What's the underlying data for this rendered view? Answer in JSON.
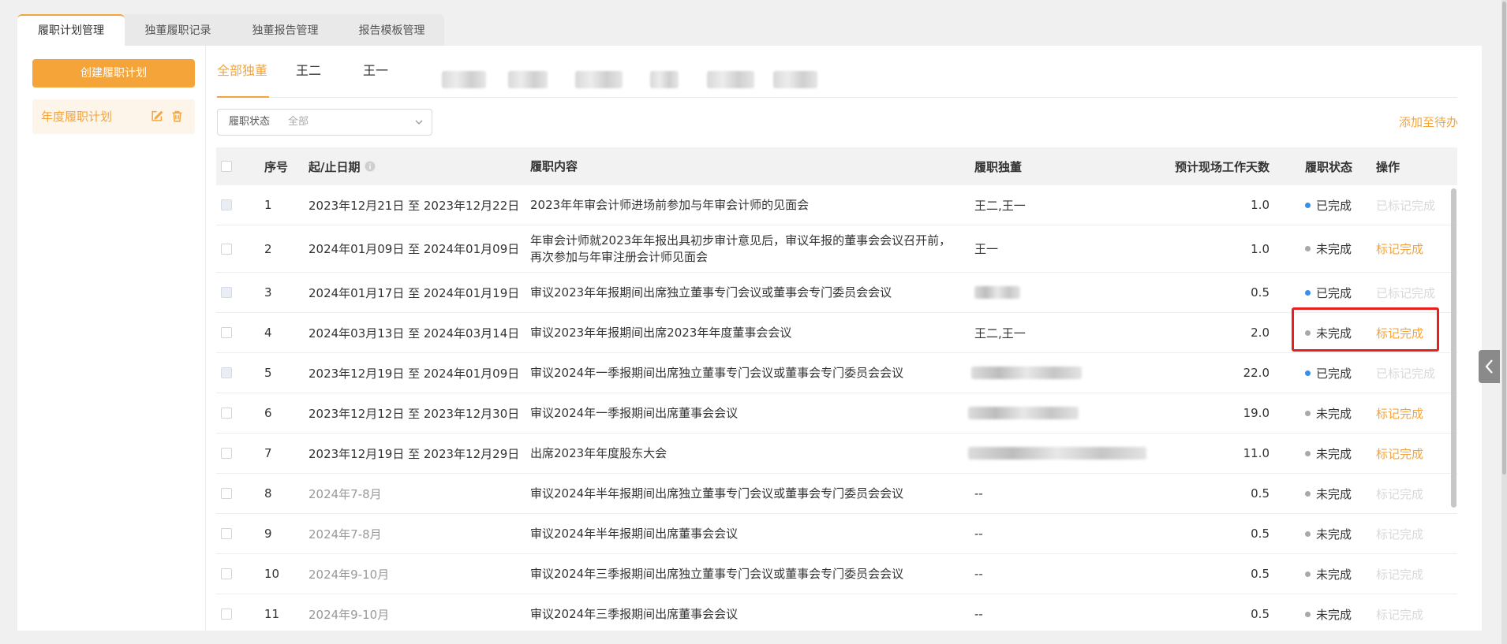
{
  "tabs": [
    "履职计划管理",
    "独董履职记录",
    "独董报告管理",
    "报告模板管理"
  ],
  "left": {
    "create_button": "创建履职计划",
    "plan_item": "年度履职计划"
  },
  "subtabs": {
    "all": "全部独董",
    "names": [
      "王二",
      "王一"
    ]
  },
  "filter": {
    "label": "履职状态",
    "value": "全部"
  },
  "add_todo": "添加至待办",
  "table": {
    "headers": {
      "index": "序号",
      "date": "起/止日期",
      "content": "履职内容",
      "people": "履职独董",
      "days": "预计现场工作天数",
      "status": "履职状态",
      "action": "操作"
    },
    "rows": [
      {
        "index": "1",
        "date": "2023年12月21日 至 2023年12月22日",
        "content": "2023年年审会计师进场前参加与年审会计师的见面会",
        "people": "王二,王一",
        "days": "1.0",
        "status": "已完成",
        "action": "已标记完成"
      },
      {
        "index": "2",
        "date": "2024年01月09日 至 2024年01月09日",
        "content": "年审会计师就2023年年报出具初步审计意见后，审议年报的董事会会议召开前，再次参加与年审注册会计师见面会",
        "people": "王一",
        "days": "1.0",
        "status": "未完成",
        "action": "标记完成"
      },
      {
        "index": "3",
        "date": "2024年01月17日 至 2024年01月19日",
        "content": "审议2023年年报期间出席独立董事专门会议或董事会专门委员会会议",
        "people": "",
        "days": "0.5",
        "status": "已完成",
        "action": "已标记完成"
      },
      {
        "index": "4",
        "date": "2024年03月13日 至 2024年03月14日",
        "content": "审议2023年年报期间出席2023年年度董事会会议",
        "people": "王二,王一",
        "days": "2.0",
        "status": "未完成",
        "action": "标记完成"
      },
      {
        "index": "5",
        "date": "2023年12月19日 至 2024年01月09日",
        "content": "审议2024年一季报期间出席独立董事专门会议或董事会专门委员会会议",
        "people": "",
        "days": "22.0",
        "status": "已完成",
        "action": "已标记完成"
      },
      {
        "index": "6",
        "date": "2023年12月12日 至 2023年12月30日",
        "content": "审议2024年一季报期间出席董事会会议",
        "people": "",
        "days": "19.0",
        "status": "未完成",
        "action": "标记完成"
      },
      {
        "index": "7",
        "date": "2023年12月19日 至 2023年12月29日",
        "content": "出席2023年年度股东大会",
        "people": "",
        "days": "11.0",
        "status": "未完成",
        "action": "标记完成"
      },
      {
        "index": "8",
        "date": "2024年7-8月",
        "content": "审议2024年半年报期间出席独立董事专门会议或董事会专门委员会会议",
        "people": "--",
        "days": "0.5",
        "status": "未完成",
        "action": "标记完成"
      },
      {
        "index": "9",
        "date": "2024年7-8月",
        "content": "审议2024年半年报期间出席董事会会议",
        "people": "--",
        "days": "0.5",
        "status": "未完成",
        "action": "标记完成"
      },
      {
        "index": "10",
        "date": "2024年9-10月",
        "content": "审议2024年三季报期间出席独立董事专门会议或董事会专门委员会会议",
        "people": "--",
        "days": "0.5",
        "status": "未完成",
        "action": "标记完成"
      },
      {
        "index": "11",
        "date": "2024年9-10月",
        "content": "审议2024年三季报期间出席董事会会议",
        "people": "--",
        "days": "0.5",
        "status": "未完成",
        "action": "标记完成"
      }
    ]
  },
  "colors": {
    "accent": "#f5a43a",
    "done_dot": "#3a8ee6",
    "undone_dot": "#a8a8a8",
    "highlight": "#e8201d"
  },
  "icons": [
    "edit-icon",
    "trash-icon",
    "info-icon",
    "chevron-down-icon",
    "chevron-left-icon"
  ]
}
